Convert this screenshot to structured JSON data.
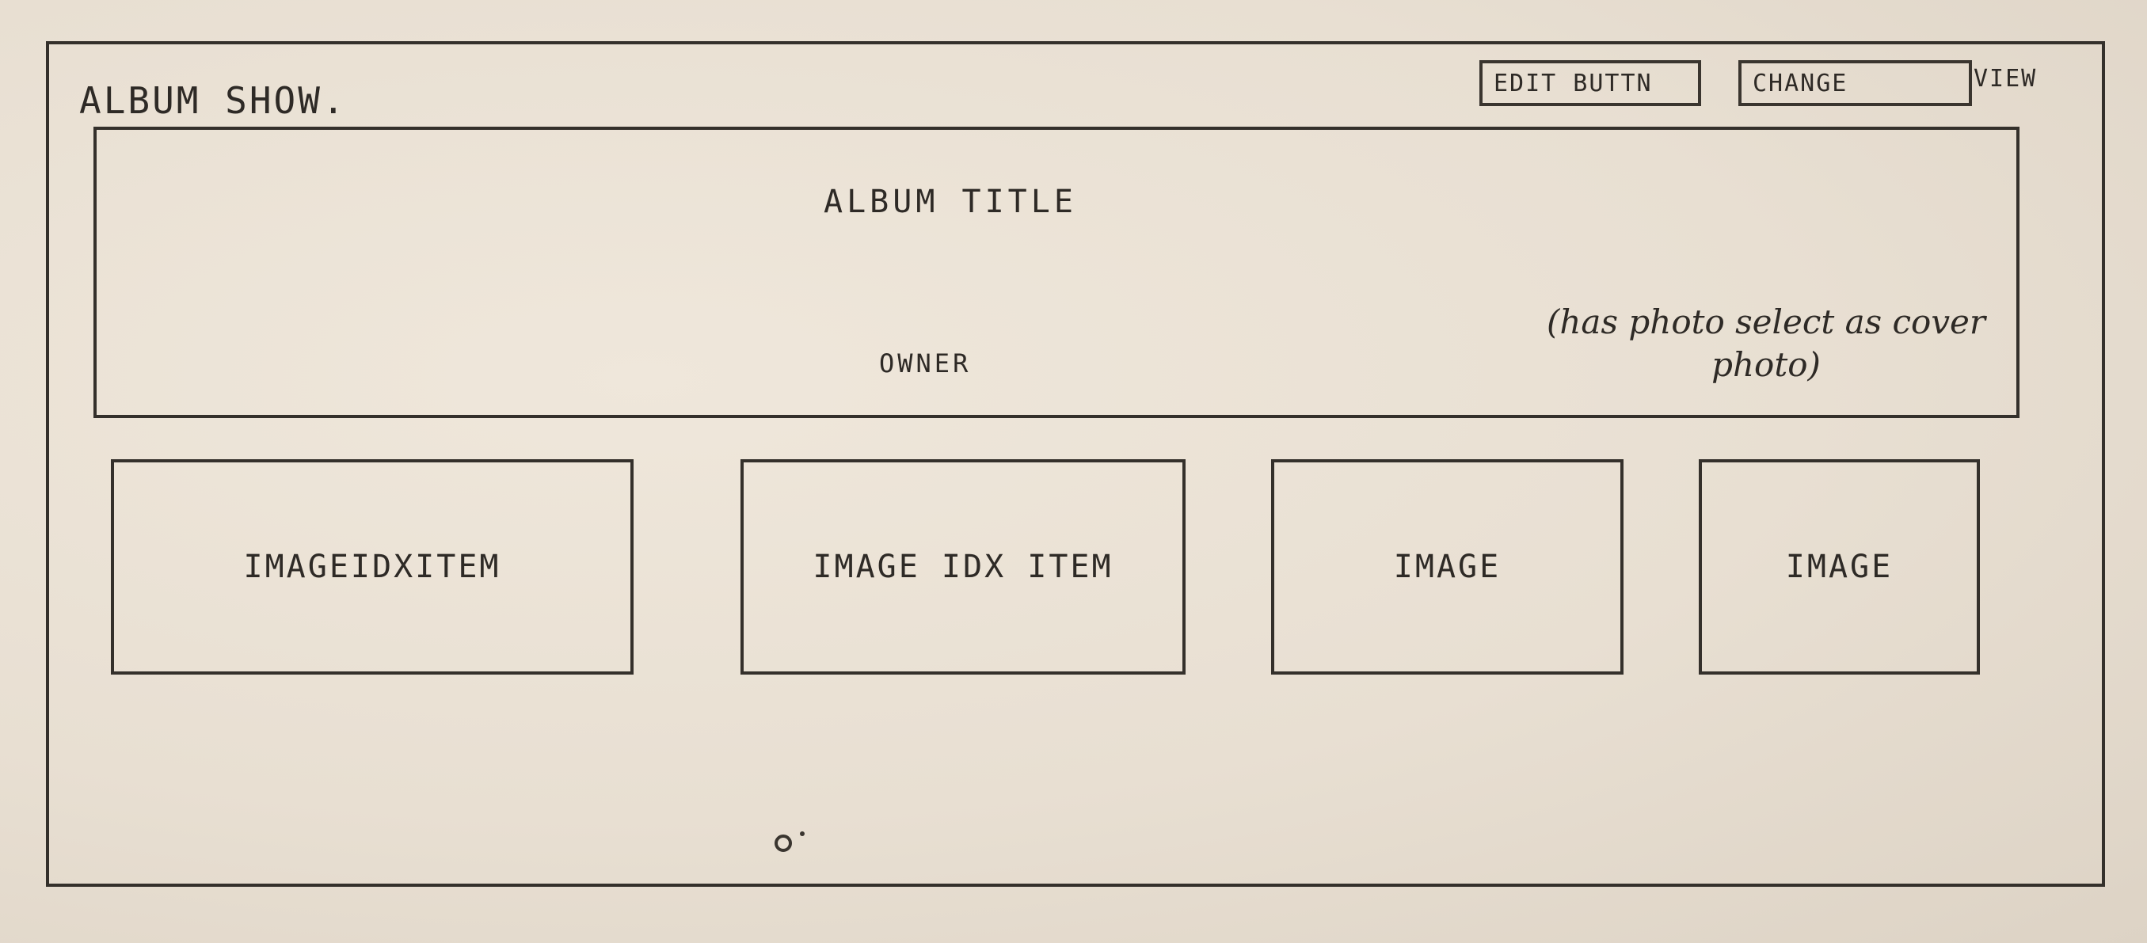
{
  "page": {
    "title": "ALBUM SHOW."
  },
  "toolbar": {
    "edit_label": "EDIT BUTTN",
    "change_view_label": "CHANGE",
    "change_view_tail": "VIEW"
  },
  "cover": {
    "album_title": "ALBUM TITLE",
    "owner": "OWNER",
    "note": "(has photo select as cover photo)"
  },
  "items": [
    {
      "label": "IMAGEIDXITEM"
    },
    {
      "label": "IMAGE IDX ITEM"
    },
    {
      "label": "IMAGE"
    },
    {
      "label": "IMAGE"
    }
  ],
  "colors": {
    "paper": "#e9e0d3",
    "ink": "#2e2a26"
  }
}
